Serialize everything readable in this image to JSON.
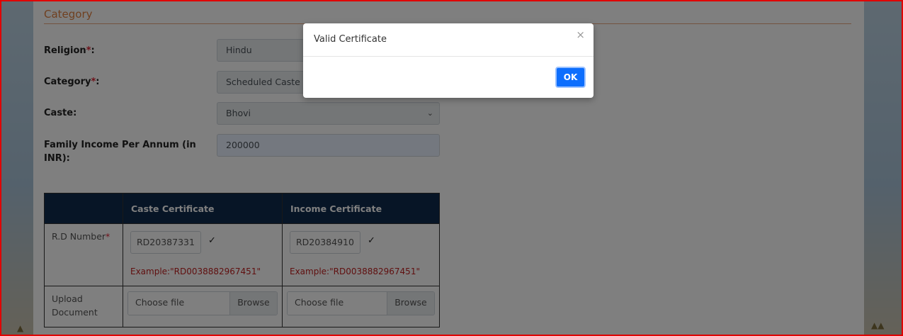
{
  "section": {
    "title": "Category"
  },
  "form": {
    "religion": {
      "label": "Religion",
      "required_mark": "*",
      "colon": ":",
      "value": "Hindu"
    },
    "category": {
      "label": "Category",
      "required_mark": "*",
      "colon": ":",
      "value": "Scheduled Caste"
    },
    "caste": {
      "label": "Caste:",
      "value": "Bhovi"
    },
    "income": {
      "label": "Family Income Per Annum (in INR):",
      "value": "200000"
    }
  },
  "docs_table": {
    "headers": [
      "",
      "Caste Certificate",
      "Income Certificate"
    ],
    "rd_row": {
      "label": "R.D Number",
      "required_mark": "*",
      "caste_value": "RD20387331",
      "income_value": "RD20384910",
      "check": "✓",
      "example": "Example:\"RD0038882967451\""
    },
    "upload_row": {
      "label": "Upload Document",
      "choose": "Choose file",
      "browse": "Browse"
    }
  },
  "modal": {
    "title": "Valid Certificate",
    "close": "×",
    "ok": "OK"
  },
  "colors": {
    "accent": "#0d6efd",
    "header_bg": "#0f2a4d",
    "error": "#c02020",
    "section": "#e08040"
  }
}
